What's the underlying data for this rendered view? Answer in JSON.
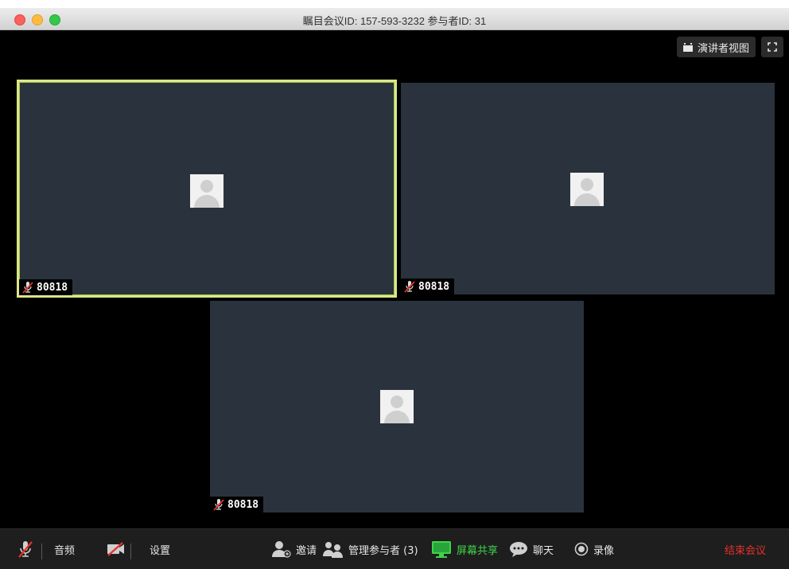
{
  "window": {
    "title": "瞩目会议ID: 157-593-3232 参与者ID: 31"
  },
  "stage": {
    "speaker_view_label": "演讲者视图"
  },
  "tiles": [
    {
      "name": "80818",
      "active": true
    },
    {
      "name": "80818",
      "active": false
    },
    {
      "name": "80818",
      "active": false
    }
  ],
  "toolbar": {
    "audio_label": "音频",
    "settings_label": "设置",
    "invite_label": "邀请",
    "manage_participants_label": "管理参与者 (3)",
    "share_screen_label": "屏幕共享",
    "chat_label": "聊天",
    "record_label": "录像",
    "end_meeting_label": "结束会议"
  },
  "colors": {
    "share_green": "#3fd34a",
    "end_red": "#e8302b",
    "active_border": "#dce68a"
  }
}
